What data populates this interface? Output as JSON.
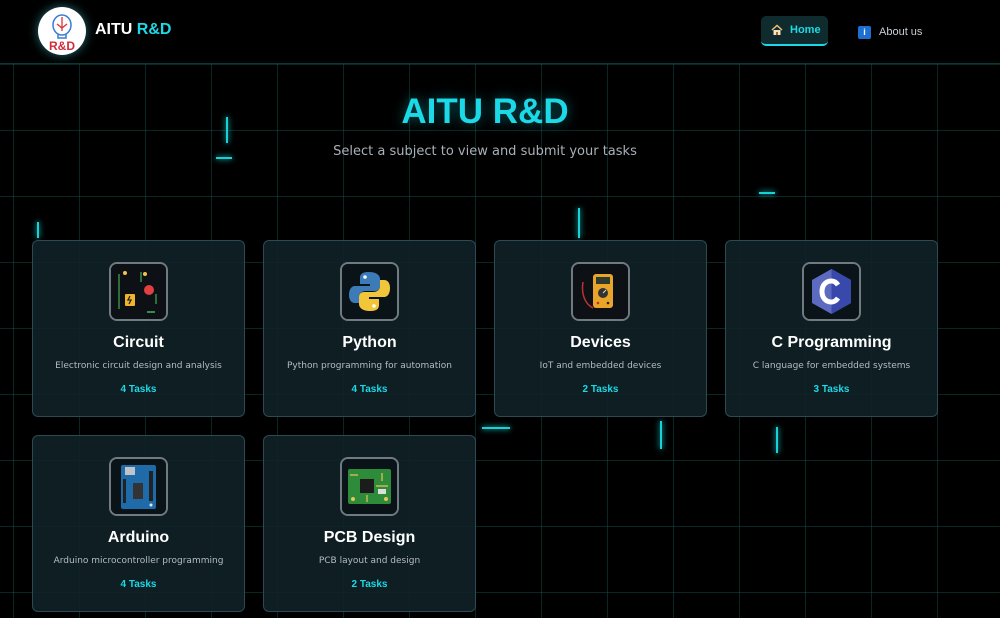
{
  "header": {
    "brand_part1": "AITU",
    "brand_part2": "R&D",
    "logo_text": "R&D",
    "nav": {
      "home_label": "Home",
      "home_icon": "house-icon",
      "about_label": "About us",
      "about_icon": "info-icon",
      "about_icon_glyph": "i"
    }
  },
  "hero": {
    "title": "AITU R&D",
    "subtitle": "Select a subject to view and submit your tasks"
  },
  "colors": {
    "accent": "#1bd9e6",
    "background": "#000000",
    "card_bg": "#102228",
    "grid": "#1ea096"
  },
  "subjects": [
    {
      "title": "Circuit",
      "description": "Electronic circuit design and analysis",
      "count": "4 Tasks",
      "icon": "circuit-icon"
    },
    {
      "title": "Python",
      "description": "Python programming for automation",
      "count": "4 Tasks",
      "icon": "python-logo-icon"
    },
    {
      "title": "Devices",
      "description": "IoT and embedded devices",
      "count": "2 Tasks",
      "icon": "multimeter-icon"
    },
    {
      "title": "C Programming",
      "description": "C language for embedded systems",
      "count": "3 Tasks",
      "icon": "c-language-icon"
    },
    {
      "title": "Arduino",
      "description": "Arduino microcontroller programming",
      "count": "4 Tasks",
      "icon": "arduino-board-icon"
    },
    {
      "title": "PCB Design",
      "description": "PCB layout and design",
      "count": "2 Tasks",
      "icon": "pcb-chip-icon"
    }
  ]
}
